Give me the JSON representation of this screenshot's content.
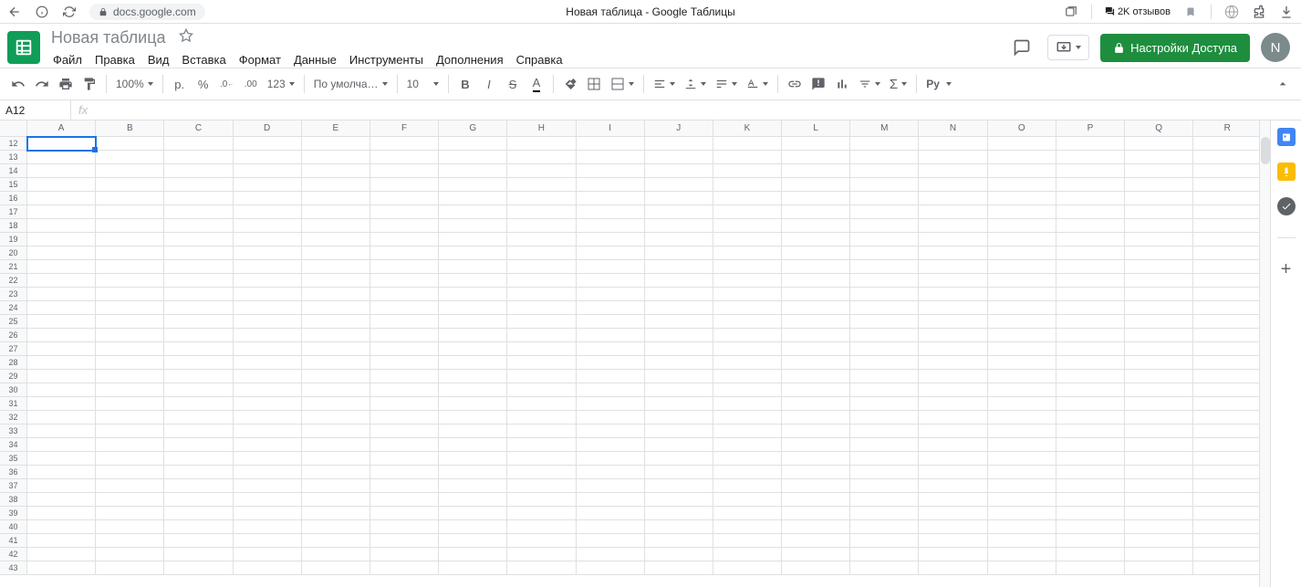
{
  "browser": {
    "url": "docs.google.com",
    "page_title": "Новая таблица - Google Таблицы",
    "reviews": "2K отзывов"
  },
  "doc": {
    "title": "Новая таблица",
    "avatar_letter": "N"
  },
  "menus": [
    "Файл",
    "Правка",
    "Вид",
    "Вставка",
    "Формат",
    "Данные",
    "Инструменты",
    "Дополнения",
    "Справка"
  ],
  "share_button": "Настройки Доступа",
  "toolbar": {
    "zoom": "100%",
    "currency": "р.",
    "percent": "%",
    "dec_decrease": ".0",
    "dec_increase": ".00",
    "format_123": "123",
    "font": "По умолча…",
    "font_size": "10",
    "input_tools": "Рy"
  },
  "formula_bar": {
    "cell_ref": "A12",
    "fx": "fx"
  },
  "grid": {
    "columns": [
      "A",
      "B",
      "C",
      "D",
      "E",
      "F",
      "G",
      "H",
      "I",
      "J",
      "K",
      "L",
      "M",
      "N",
      "O",
      "P",
      "Q",
      "R"
    ],
    "row_start": 12,
    "row_end": 43,
    "selected_cell": "A12"
  }
}
